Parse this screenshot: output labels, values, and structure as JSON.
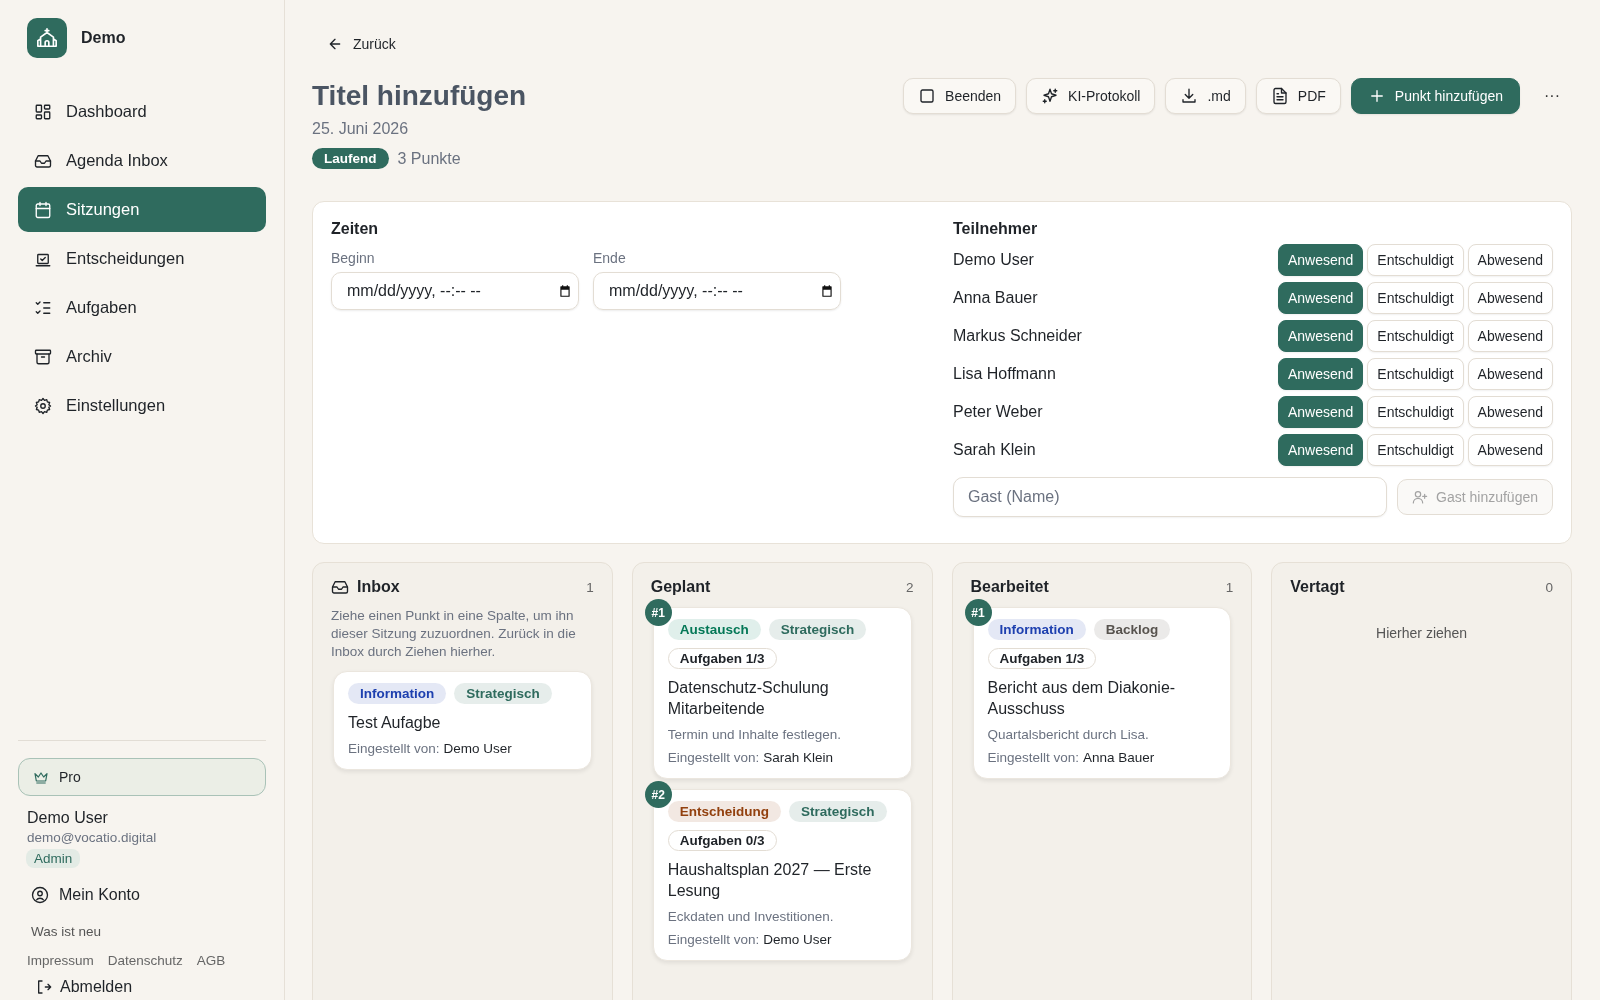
{
  "sidebar": {
    "brand": "Demo",
    "nav": [
      {
        "label": "Dashboard",
        "selected": false
      },
      {
        "label": "Agenda Inbox",
        "selected": false
      },
      {
        "label": "Sitzungen",
        "selected": true
      },
      {
        "label": "Entscheidungen",
        "selected": false
      },
      {
        "label": "Aufgaben",
        "selected": false
      },
      {
        "label": "Archiv",
        "selected": false
      },
      {
        "label": "Einstellungen",
        "selected": false
      }
    ],
    "plan": "Pro",
    "user": {
      "name": "Demo User",
      "email": "demo@vocatio.digital",
      "role": "Admin"
    },
    "account": "Mein Konto",
    "whats_new": "Was ist neu",
    "links": [
      "Impressum",
      "Datenschutz",
      "AGB"
    ],
    "logout": "Abmelden"
  },
  "back": "Zurück",
  "header": {
    "title": "Titel hinzufügen",
    "date": "25. Juni 2026",
    "status": "Laufend",
    "count": "3 Punkte",
    "actions": [
      {
        "label": "Beenden",
        "kind": "outline"
      },
      {
        "label": "KI-Protokoll",
        "kind": "outline"
      },
      {
        "label": ".md",
        "kind": "outline"
      },
      {
        "label": "PDF",
        "kind": "outline"
      },
      {
        "label": "Punkt hinzufügen",
        "kind": "primary"
      }
    ],
    "more": "···"
  },
  "times": {
    "title": "Zeiten",
    "fields": [
      {
        "label": "Beginn",
        "value": "mm/dd/yyyy, --:-- --"
      },
      {
        "label": "Ende",
        "value": "mm/dd/yyyy, --:-- --"
      }
    ]
  },
  "participants": {
    "title": "Teilnehmer",
    "people": [
      {
        "name": "Demo User",
        "options": [
          {
            "label": "Anwesend",
            "selected": true
          },
          {
            "label": "Entschuldigt",
            "selected": false
          },
          {
            "label": "Abwesend",
            "selected": false
          }
        ]
      },
      {
        "name": "Anna Bauer",
        "options": [
          {
            "label": "Anwesend",
            "selected": true
          },
          {
            "label": "Entschuldigt",
            "selected": false
          },
          {
            "label": "Abwesend",
            "selected": false
          }
        ]
      },
      {
        "name": "Markus Schneider",
        "options": [
          {
            "label": "Anwesend",
            "selected": true
          },
          {
            "label": "Entschuldigt",
            "selected": false
          },
          {
            "label": "Abwesend",
            "selected": false
          }
        ]
      },
      {
        "name": "Lisa Hoffmann",
        "options": [
          {
            "label": "Anwesend",
            "selected": true
          },
          {
            "label": "Entschuldigt",
            "selected": false
          },
          {
            "label": "Abwesend",
            "selected": false
          }
        ]
      },
      {
        "name": "Peter Weber",
        "options": [
          {
            "label": "Anwesend",
            "selected": true
          },
          {
            "label": "Entschuldigt",
            "selected": false
          },
          {
            "label": "Abwesend",
            "selected": false
          }
        ]
      },
      {
        "name": "Sarah Klein",
        "options": [
          {
            "label": "Anwesend",
            "selected": true
          },
          {
            "label": "Entschuldigt",
            "selected": false
          },
          {
            "label": "Abwesend",
            "selected": false
          }
        ]
      }
    ],
    "guest": {
      "placeholder": "Gast (Name)",
      "button": "Gast hinzufügen",
      "disabled": true
    }
  },
  "columns": [
    {
      "title": "Inbox",
      "kind": "inbox",
      "count": "1",
      "hint": "Ziehe einen Punkt in eine Spalte, um ihn dieser Sitzung zuzuordnen. Zurück in die Inbox durch Ziehen hierher.",
      "cards": [
        {
          "tags": [
            {
              "label": "Information",
              "color": "#1e40af"
            },
            {
              "label": "Strategisch",
              "color": "#2f6b5e"
            }
          ],
          "title": "Test Aufagbe",
          "by_label": "Eingestellt von:",
          "by": "Demo User"
        }
      ]
    },
    {
      "title": "Geplant",
      "kind": "plain",
      "count": "2",
      "cards": [
        {
          "number": "#1",
          "tags": [
            {
              "label": "Austausch",
              "color": "#047857"
            },
            {
              "label": "Strategisch",
              "color": "#2f6b5e"
            }
          ],
          "tasks": "Aufgaben 1/3",
          "title": "Datenschutz-Schulung Mitarbeitende",
          "description": "Termin und Inhalte festlegen.",
          "by_label": "Eingestellt von:",
          "by": "Sarah Klein"
        },
        {
          "number": "#2",
          "tags": [
            {
              "label": "Entscheidung",
              "color": "#92400e"
            },
            {
              "label": "Strategisch",
              "color": "#2f6b5e"
            }
          ],
          "tasks": "Aufgaben 0/3",
          "title": "Haushaltsplan 2027 — Erste Lesung",
          "description": "Eckdaten und Investitionen.",
          "by_label": "Eingestellt von:",
          "by": "Demo User"
        }
      ]
    },
    {
      "title": "Bearbeitet",
      "kind": "plain",
      "count": "1",
      "cards": [
        {
          "number": "#1",
          "tags": [
            {
              "label": "Information",
              "color": "#1e40af"
            },
            {
              "label": "Backlog",
              "color": "#57534e"
            }
          ],
          "tasks": "Aufgaben 1/3",
          "title": "Bericht aus dem Diakonie-Ausschuss",
          "description": "Quartalsbericht durch Lisa.",
          "by_label": "Eingestellt von:",
          "by": "Anna Bauer"
        }
      ]
    },
    {
      "title": "Vertagt",
      "kind": "plain",
      "count": "0",
      "empty": "Hierher ziehen"
    }
  ]
}
